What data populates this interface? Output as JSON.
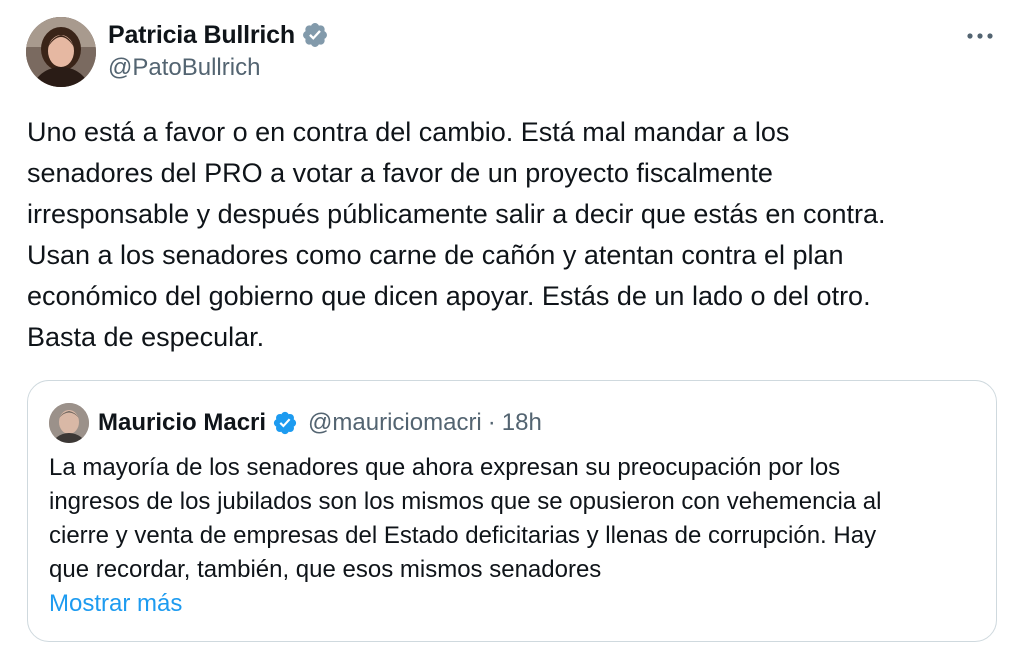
{
  "tweet": {
    "author": {
      "display_name": "Patricia Bullrich",
      "handle": "@PatoBullrich",
      "verified": true
    },
    "text": "Uno está a favor o en contra del cambio. Está mal mandar a los\nsenadores del PRO a votar a favor de un proyecto fiscalmente\nirresponsable y después públicamente salir a decir que estás en contra.\nUsan a los senadores como carne de cañón y atentan contra el plan\neconómico del gobierno que dicen apoyar. Estás de un lado o del otro.\nBasta de especular."
  },
  "quote": {
    "author": {
      "display_name": "Mauricio Macri",
      "handle": "@mauriciomacri",
      "verified": true
    },
    "separator": "·",
    "time": "18h",
    "text": "La mayoría de los senadores que ahora expresan su preocupación por los\ningresos de los jubilados son los mismos que se opusieron con vehemencia al\ncierre y venta de empresas del Estado deficitarias y llenas de corrupción. Hay\nque recordar, también, que esos mismos senadores",
    "show_more": "Mostrar más"
  },
  "colors": {
    "text_primary": "#0f1419",
    "text_secondary": "#536471",
    "accent": "#1d9bf0",
    "border": "#cfd9de"
  },
  "icons": {
    "verified": "verified-badge-icon",
    "more": "more-horizontal-icon"
  }
}
